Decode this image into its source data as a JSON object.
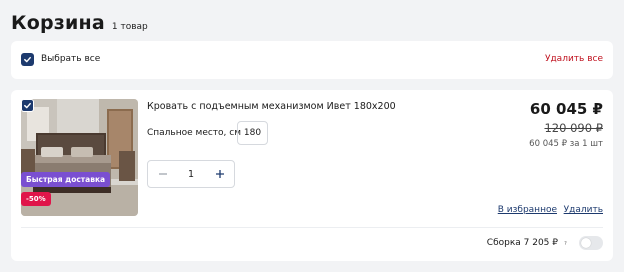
{
  "header": {
    "title": "Корзина",
    "count": "1 товар"
  },
  "select_all": {
    "label": "Выбрать все",
    "delete_all": "Удалить все",
    "checked": true
  },
  "item": {
    "checked": true,
    "name": "Кровать с подъемным механизмом Ивет 180x200",
    "option_label": "Спальное место, см",
    "option_value": "180",
    "badges": {
      "delivery": "Быстрая доставка",
      "discount": "-50%"
    },
    "quantity": "1",
    "price": "60 045 ₽",
    "old_price": "120 090 ₽",
    "unit_price": "60 045 ₽ за 1 шт",
    "favorite_link": "В избранное",
    "remove_link": "Удалить",
    "assembly_label": "Сборка 7 205 ₽",
    "assembly_help": "?",
    "assembly_enabled": false
  },
  "icons": {
    "checkbox": "check-icon",
    "minus": "minus-icon",
    "plus": "plus-icon",
    "help": "question-icon"
  },
  "colors": {
    "accent": "#1d3a6e",
    "danger": "#c0121f",
    "delivery_badge": "#7a4fd1",
    "discount_badge": "#e0154a"
  }
}
